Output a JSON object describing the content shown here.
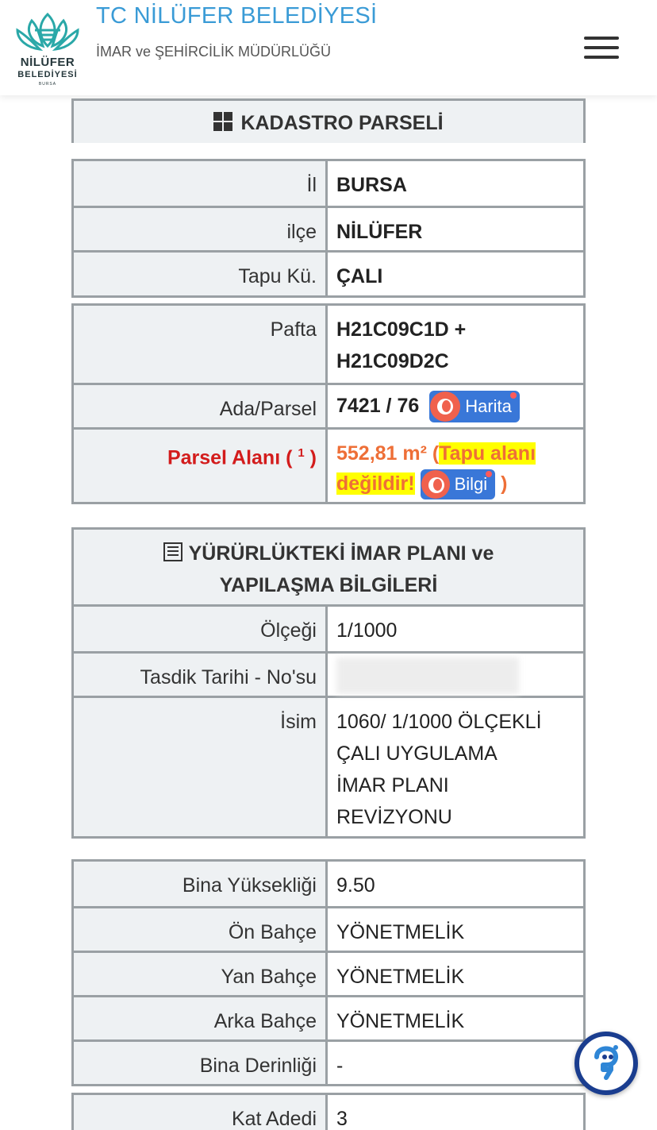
{
  "header": {
    "logo_line1": "NİLÜFER",
    "logo_line2": "BELEDİYESİ",
    "logo_line3": "BURSA",
    "title": "TC NİLÜFER BELEDİYESİ",
    "subtitle": "İMAR ve ŞEHİRCİLİK MÜDÜRLÜĞÜ"
  },
  "kadastro": {
    "section_title": "KADASTRO PARSELİ",
    "location": [
      {
        "label": "İl",
        "value": "BURSA"
      },
      {
        "label": "ilçe",
        "value": "NİLÜFER"
      },
      {
        "label": "Tapu Kü.",
        "value": "ÇALI"
      }
    ],
    "pafta_label": "Pafta",
    "pafta_value_1": "H21C09C1D +",
    "pafta_value_2": "H21C09D2C",
    "ada_label": "Ada/Parsel",
    "ada_value": "7421 / 76",
    "harita_button": "Harita",
    "alan_label": "Parsel Alanı (",
    "alan_sup": "1",
    "alan_close": ")",
    "alan_value": "552,81 m²",
    "alan_paren_open": "(",
    "alan_note_1": "Tapu alanı",
    "alan_note_2": "değildir!",
    "bilgi_button": "Bilgi",
    "alan_paren_close": ")"
  },
  "imar": {
    "section_title_1": "YÜRÜRLÜKTEKİ İMAR PLANI ve",
    "section_title_2": "YAPILAŞMA BİLGİLERİ",
    "olcek_label": "Ölçeği",
    "olcek_value": "1/1000",
    "tasdik_label": "Tasdik Tarihi - No'su",
    "isim_label": "İsim",
    "isim_lines": [
      "1060/ 1/1000 ÖLÇEKLİ",
      "ÇALI UYGULAMA",
      "İMAR PLANI",
      "REVİZYONU"
    ]
  },
  "yapilasma": {
    "rows": [
      {
        "label": "Bina Yüksekliği",
        "value": "9.50"
      },
      {
        "label": "Ön Bahçe",
        "value": "YÖNETMELİK"
      },
      {
        "label": "Yan Bahçe",
        "value": "YÖNETMELİK"
      },
      {
        "label": "Arka Bahçe",
        "value": "YÖNETMELİK"
      },
      {
        "label": "Bina Derinliği",
        "value": "-"
      }
    ],
    "kat_label": "Kat Adedi",
    "kat_value": "3"
  },
  "colors": {
    "title_blue": "#3a9bd6",
    "warning_red": "#d31c1c",
    "area_orange": "#ee6f37",
    "highlight_yellow": "#ffff00",
    "button_blue": "#3977d8",
    "chat_border": "#1a3d8f"
  },
  "icons": {
    "section_kadastro": "grid-icon",
    "section_imar": "list-icon",
    "map_button": "globe-icon",
    "menu": "hamburger-icon",
    "support": "chat-icon"
  }
}
